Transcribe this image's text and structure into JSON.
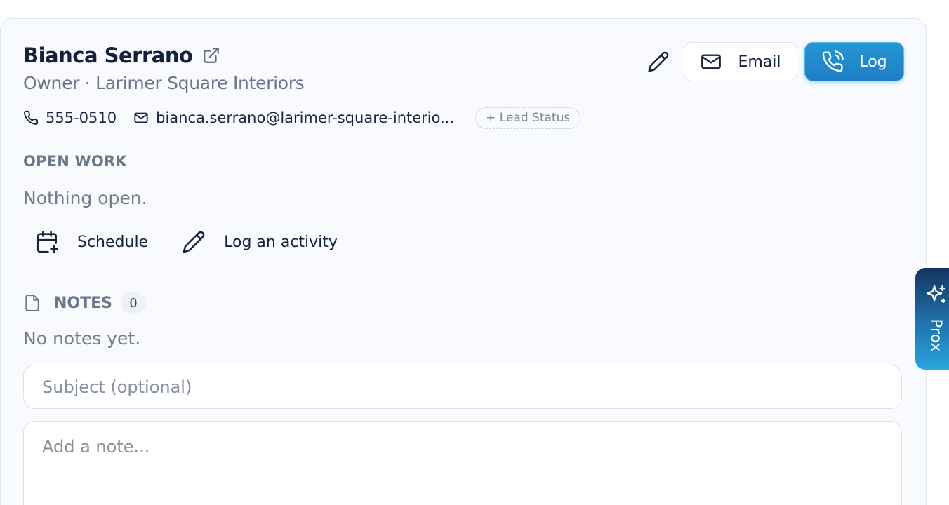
{
  "contact": {
    "name": "Bianca Serrano",
    "subtitle": "Owner · Larimer Square Interiors",
    "phone": "555-0510",
    "email": "bianca.serrano@larimer-square-interio...",
    "lead_status_label": "+ Lead Status"
  },
  "actions": {
    "email_label": "Email",
    "log_label": "Log"
  },
  "open_work": {
    "heading": "OPEN WORK",
    "empty_text": "Nothing open.",
    "schedule_label": "Schedule",
    "log_activity_label": "Log an activity"
  },
  "notes": {
    "heading": "NOTES",
    "count": "0",
    "empty_text": "No notes yet.",
    "subject_placeholder": "Subject (optional)",
    "note_placeholder": "Add a note..."
  },
  "assistant": {
    "label": "Prox"
  },
  "colors": {
    "accent": "#2596d4",
    "text_primary": "#14213d",
    "text_muted": "#6c7787"
  },
  "icons": [
    "external-link-icon",
    "pencil-icon",
    "mail-icon",
    "phone-call-icon",
    "phone-icon",
    "calendar-plus-icon",
    "file-icon",
    "sparkles-icon"
  ]
}
